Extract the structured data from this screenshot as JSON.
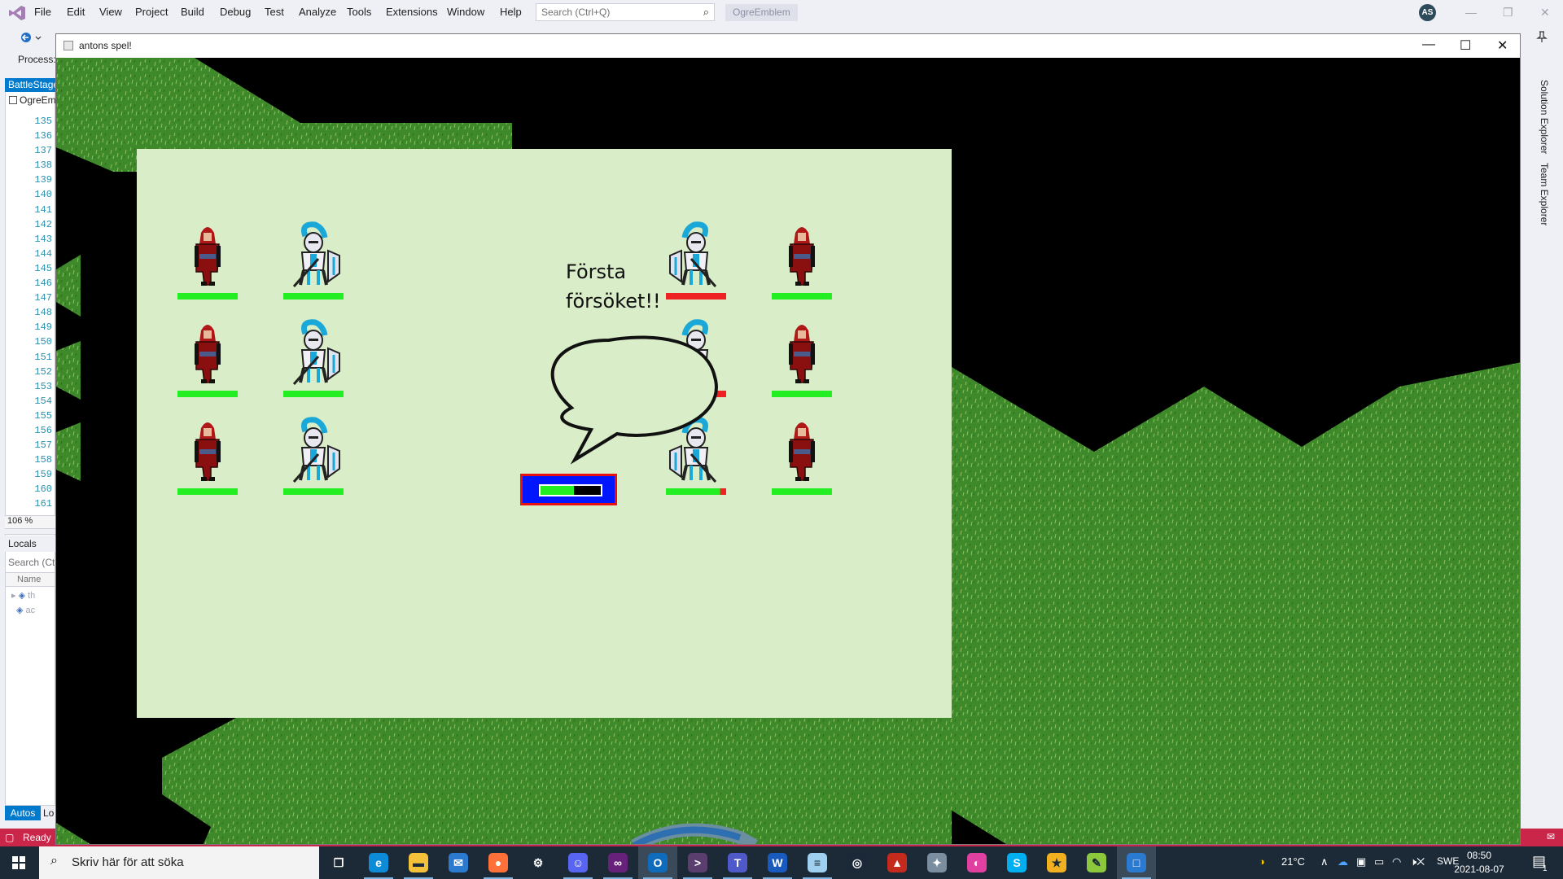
{
  "vs": {
    "menu": [
      "File",
      "Edit",
      "View",
      "Project",
      "Build",
      "Debug",
      "Test",
      "Analyze",
      "Tools",
      "Extensions",
      "Window",
      "Help"
    ],
    "search_placeholder": "Search (Ctrl+Q)",
    "solution_name": "OgreEmblem",
    "user_initials": "AS",
    "process_label": "Process:",
    "editor_tab": "BattleStage",
    "editor_file": "OgreEm",
    "line_numbers": [
      "135",
      "136",
      "137",
      "138",
      "139",
      "140",
      "141",
      "142",
      "143",
      "144",
      "145",
      "146",
      "147",
      "148",
      "149",
      "150",
      "151",
      "152",
      "153",
      "154",
      "155",
      "156",
      "157",
      "158",
      "159",
      "160",
      "161"
    ],
    "zoom": "106 %",
    "locals_title": "Locals",
    "locals_search": "Search (Ct",
    "locals_name_header": "Name",
    "locals_rows": [
      "th",
      "ac"
    ],
    "bottom_tabs": {
      "autos": "Autos",
      "locals": "Lo"
    },
    "side_tabs": [
      "Solution Explorer",
      "Team Explorer"
    ],
    "status": "Ready"
  },
  "game": {
    "window_title": "antons spel!",
    "speech": "Första försöket!!",
    "turn_meter_fraction": 0.55,
    "colors": {
      "stage_bg": "#d9edc8",
      "hp_full": "#22ee22",
      "hp_lost": "#ee2222",
      "grass": "#3e8a2a"
    },
    "units": [
      {
        "type": "ogre",
        "side": "left",
        "row": 0,
        "col": 0,
        "hp": 1.0
      },
      {
        "type": "knight",
        "side": "left",
        "row": 0,
        "col": 1,
        "hp": 1.0
      },
      {
        "type": "ogre",
        "side": "left",
        "row": 1,
        "col": 0,
        "hp": 1.0
      },
      {
        "type": "knight",
        "side": "left",
        "row": 1,
        "col": 1,
        "hp": 1.0
      },
      {
        "type": "ogre",
        "side": "left",
        "row": 2,
        "col": 0,
        "hp": 1.0
      },
      {
        "type": "knight",
        "side": "left",
        "row": 2,
        "col": 1,
        "hp": 1.0
      },
      {
        "type": "knight",
        "side": "right",
        "row": 0,
        "col": 0,
        "hp": 0.0
      },
      {
        "type": "ogre",
        "side": "right",
        "row": 0,
        "col": 1,
        "hp": 1.0
      },
      {
        "type": "knight",
        "side": "right",
        "row": 1,
        "col": 0,
        "hp": 0.6
      },
      {
        "type": "ogre",
        "side": "right",
        "row": 1,
        "col": 1,
        "hp": 1.0
      },
      {
        "type": "knight",
        "side": "right",
        "row": 2,
        "col": 0,
        "hp": 0.9
      },
      {
        "type": "ogre",
        "side": "right",
        "row": 2,
        "col": 1,
        "hp": 1.0
      }
    ]
  },
  "taskbar": {
    "search_placeholder": "Skriv här för att söka",
    "apps": [
      "task-view",
      "edge",
      "file-explorer",
      "mail",
      "firefox",
      "settings",
      "discord",
      "visual-studio",
      "outlook",
      "terminal",
      "teams",
      "word",
      "notepad",
      "steam",
      "app-red",
      "app-gear",
      "app-circle",
      "skype",
      "app-star",
      "notepad-plus",
      "game-window"
    ],
    "weather": "21°C",
    "language": "SWE",
    "time": "08:50",
    "date": "2021-08-07",
    "notification_count": "1"
  }
}
